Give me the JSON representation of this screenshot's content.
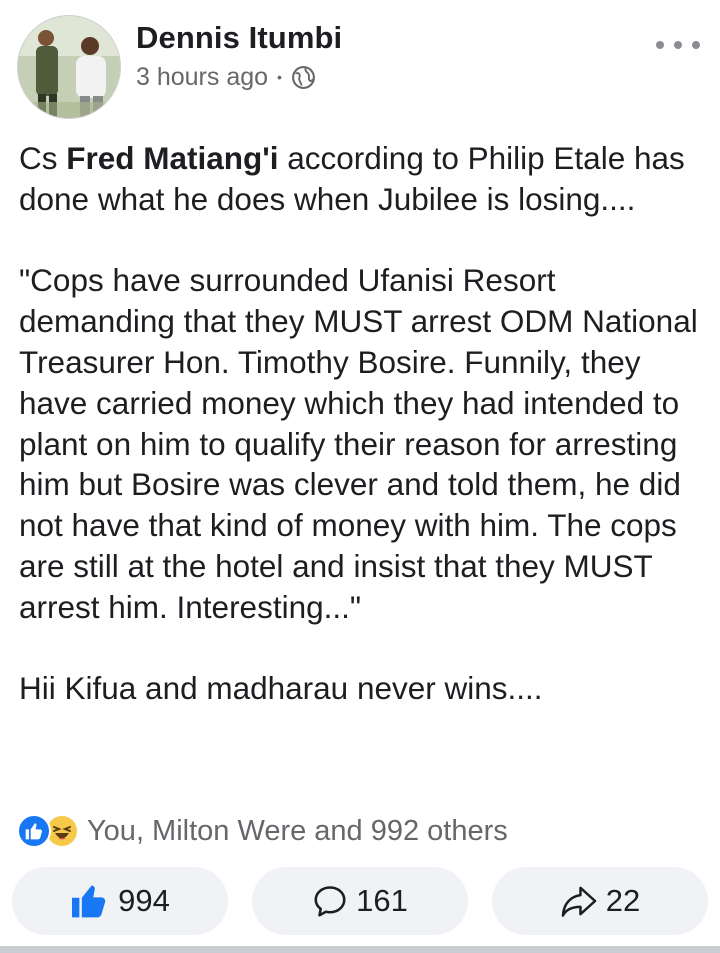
{
  "post": {
    "author": "Dennis Itumbi",
    "time": "3 hours ago",
    "audience_icon": "globe-icon",
    "menu_icon": "more-options-icon",
    "text": {
      "p1_prefix": "Cs ",
      "p1_bold": "Fred Matiang'i",
      "p1_rest": " according to Philip Etale has done what he does when Jubilee is losing....",
      "p2": "\"Cops have surrounded Ufanisi Resort demanding that they MUST arrest ODM National Treasurer Hon. Timothy Bosire. Funnily, they have carried money which they had intended to plant on him to qualify their reason for arresting him but Bosire was clever and told them, he did not have that kind of money with him. The cops are still at the hotel and insist that they MUST arrest him. Interesting...\"",
      "p3": "Hii Kifua and madharau never wins...."
    }
  },
  "reactions": {
    "icons": [
      "like-reaction-icon",
      "haha-reaction-icon"
    ],
    "summary": "You, Milton Were and 992 others"
  },
  "actions": {
    "like_count": "994",
    "comment_count": "161",
    "share_count": "22"
  },
  "colors": {
    "brand_blue": "#1877f2",
    "secondary_text": "#65676b",
    "button_bg": "#f0f2f5"
  }
}
